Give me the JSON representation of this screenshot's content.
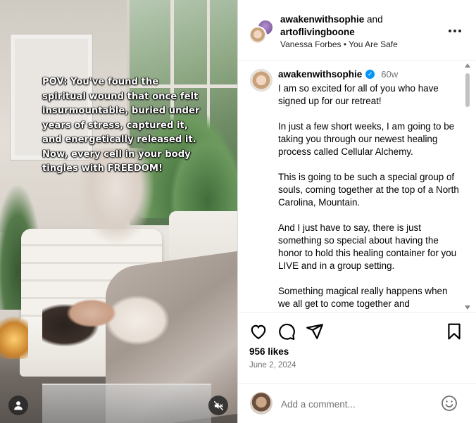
{
  "media": {
    "overlay_lines": [
      "POV: You've found the",
      "spiritual wound that once felt",
      "insurmountable, buried under",
      "years of stress, captured it,",
      "and energetically released it.",
      "Now, every cell in your body",
      "tingles with FREEDOM!"
    ],
    "tag_icon": "user-icon",
    "mute_icon": "muted-speaker-icon"
  },
  "header": {
    "account1": "awakenwithsophie",
    "and_text": "and",
    "account2": "artoflivingboone",
    "audio": "Vanessa Forbes • You Are Safe",
    "more_icon": "more-options-icon"
  },
  "caption": {
    "username": "awakenwithsophie",
    "verified_mark": "✓",
    "time": "60w",
    "paragraphs": [
      "I am so excited for all of you who have signed up for our retreat!",
      "In just a few short weeks, I am going to be taking you through our newest healing process called Cellular Alchemy.",
      "This is going to be such a special group of souls, coming together at the top of a North Carolina, Mountain.",
      "And I just have to say, there is just something so special about having the honor to hold this healing container for you LIVE and in a group setting.",
      "Something magical really happens when we all get to come together and"
    ]
  },
  "actions": {
    "like_icon": "heart-icon",
    "comment_icon": "comment-icon",
    "share_icon": "share-icon",
    "save_icon": "bookmark-icon"
  },
  "likes": "956 likes",
  "date": "June 2, 2024",
  "comment": {
    "placeholder": "Add a comment...",
    "emoji_icon": "emoji-icon"
  },
  "colors": {
    "verified_blue": "#0095f6",
    "secondary_text": "#737373",
    "border": "#dbdbdb"
  }
}
